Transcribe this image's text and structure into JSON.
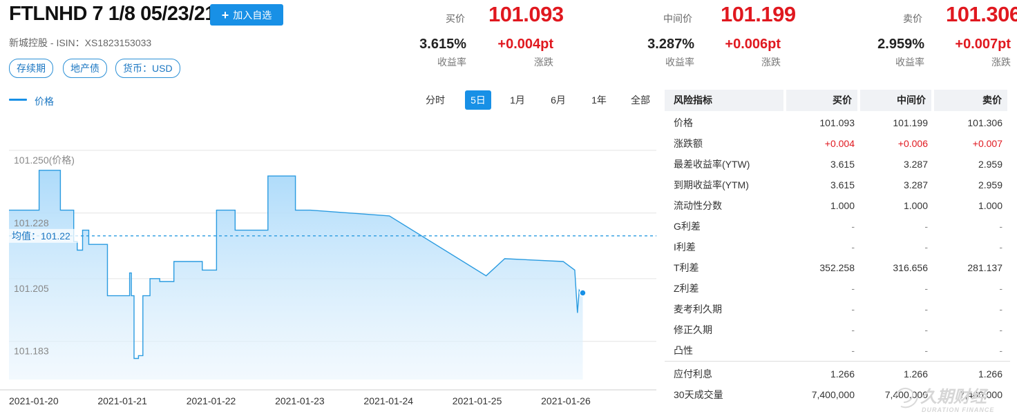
{
  "header": {
    "title": "FTLNHD 7 1/8 05/23/21",
    "add_label": "加入自选",
    "subtitle": "新城控股 - ISIN：XS1823153033",
    "tags": [
      "存续期",
      "地产债",
      "货币：USD"
    ]
  },
  "quotes": [
    {
      "label": "买价",
      "price": "101.093",
      "yield": "3.615%",
      "yield_label": "收益率",
      "change": "+0.004pt",
      "change_label": "涨跌"
    },
    {
      "label": "中间价",
      "price": "101.199",
      "yield": "3.287%",
      "yield_label": "收益率",
      "change": "+0.006pt",
      "change_label": "涨跌"
    },
    {
      "label": "卖价",
      "price": "101.306",
      "yield": "2.959%",
      "yield_label": "收益率",
      "change": "+0.007pt",
      "change_label": "涨跌"
    }
  ],
  "chart_toolbar": {
    "legend": "价格",
    "ranges": [
      "分时",
      "5日",
      "1月",
      "6月",
      "1年",
      "全部"
    ],
    "active_range": "5日"
  },
  "chart_data": {
    "type": "area",
    "series": [
      {
        "name": "价格"
      }
    ],
    "y_tick_labels": [
      "101.250(价格)",
      "101.228",
      "101.205",
      "101.183"
    ],
    "yticks": [
      101.25,
      101.228,
      101.205,
      101.183
    ],
    "ylim": [
      101.166,
      101.264
    ],
    "xticks": [
      "2021-01-20",
      "2021-01-21",
      "2021-01-22",
      "2021-01-23",
      "2021-01-24",
      "2021-01-25",
      "2021-01-26"
    ],
    "xlim": [
      0,
      7.3
    ],
    "mean_label": "均值：101.22",
    "mean_value": 101.22,
    "x": [
      0,
      0.34,
      0.34,
      0.58,
      0.58,
      0.73,
      0.73,
      0.77,
      0.77,
      0.83,
      0.83,
      0.9,
      0.9,
      1.11,
      1.11,
      1.19,
      1.19,
      1.36,
      1.36,
      1.38,
      1.38,
      1.41,
      1.41,
      1.46,
      1.46,
      1.51,
      1.51,
      1.59,
      1.59,
      1.7,
      1.7,
      1.86,
      1.86,
      2.18,
      2.18,
      2.34,
      2.34,
      2.55,
      2.55,
      2.73,
      2.73,
      2.92,
      2.92,
      3.23,
      3.23,
      3.24,
      3.26,
      3.26,
      3.4,
      3.4,
      4.29,
      4.29,
      5.38,
      5.38,
      5.59,
      5.59,
      6.25,
      6.25,
      6.38,
      6.38,
      6.41,
      6.43,
      6.45,
      6.47
    ],
    "y": [
      101.229,
      101.229,
      101.243,
      101.243,
      101.229,
      101.229,
      101.218,
      101.218,
      101.215,
      101.215,
      101.222,
      101.222,
      101.217,
      101.217,
      101.199,
      101.199,
      101.199,
      101.199,
      101.207,
      101.207,
      101.199,
      101.199,
      101.177,
      101.177,
      101.178,
      101.178,
      101.199,
      101.199,
      101.205,
      101.205,
      101.204,
      101.204,
      101.211,
      101.211,
      101.208,
      101.208,
      101.229,
      101.229,
      101.222,
      101.222,
      101.222,
      101.222,
      101.241,
      101.241,
      101.229,
      101.229,
      101.229,
      101.229,
      101.229,
      101.229,
      101.227,
      101.227,
      101.206,
      101.206,
      101.212,
      101.212,
      101.211,
      101.211,
      101.208,
      101.208,
      101.193,
      101.201,
      101.2,
      101.2
    ]
  },
  "risk_table": {
    "headers": [
      "风险指标",
      "买价",
      "中间价",
      "卖价"
    ],
    "rows": [
      {
        "label": "价格",
        "v": [
          "101.093",
          "101.199",
          "101.306"
        ]
      },
      {
        "label": "涨跌额",
        "v": [
          "+0.004",
          "+0.006",
          "+0.007"
        ]
      },
      {
        "label": "最差收益率(YTW)",
        "v": [
          "3.615",
          "3.287",
          "2.959"
        ]
      },
      {
        "label": "到期收益率(YTM)",
        "v": [
          "3.615",
          "3.287",
          "2.959"
        ]
      },
      {
        "label": "流动性分数",
        "v": [
          "1.000",
          "1.000",
          "1.000"
        ]
      },
      {
        "label": "G利差",
        "v": [
          "-",
          "-",
          "-"
        ]
      },
      {
        "label": "I利差",
        "v": [
          "-",
          "-",
          "-"
        ]
      },
      {
        "label": "T利差",
        "v": [
          "352.258",
          "316.656",
          "281.137"
        ]
      },
      {
        "label": "Z利差",
        "v": [
          "-",
          "-",
          "-"
        ]
      },
      {
        "label": "麦考利久期",
        "v": [
          "-",
          "-",
          "-"
        ]
      },
      {
        "label": "修正久期",
        "v": [
          "-",
          "-",
          "-"
        ]
      },
      {
        "label": "凸性",
        "v": [
          "-",
          "-",
          "-"
        ]
      }
    ],
    "extra_rows": [
      {
        "label": "应付利息",
        "v": [
          "1.266",
          "1.266",
          "1.266"
        ]
      },
      {
        "label": "30天成交量",
        "v": [
          "7,400,000",
          "7,400,000",
          "7,400,000"
        ]
      }
    ]
  },
  "watermark": {
    "cn": "久期财经",
    "en": "DURATION FINANCE"
  },
  "colors": {
    "accent": "#1890e6",
    "up": "#e0181f",
    "line": "#2a9be0",
    "fill": "#bfe3fb"
  }
}
